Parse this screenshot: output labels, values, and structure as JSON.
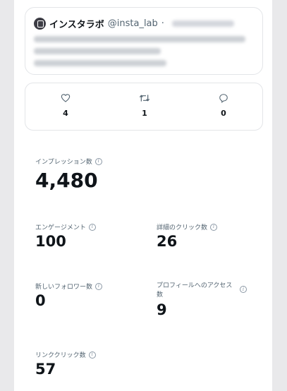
{
  "tweet": {
    "author_name": "インスタラボ",
    "author_handle": "@insta_lab",
    "separator": "·"
  },
  "engagement": {
    "likes": "4",
    "retweets": "1",
    "replies": "0",
    "icons": [
      "heart-icon",
      "retweet-icon",
      "reply-icon"
    ]
  },
  "metrics": {
    "impressions": {
      "label": "インプレッション数",
      "value": "4,480"
    },
    "engagements": {
      "label": "エンゲージメント",
      "value": "100"
    },
    "detail_clicks": {
      "label": "詳細のクリック数",
      "value": "26"
    },
    "new_followers": {
      "label": "新しいフォロワー数",
      "value": "0"
    },
    "profile_visits": {
      "label": "プロフィールへのアクセス数",
      "value": "9"
    },
    "link_clicks": {
      "label": "リンククリック数",
      "value": "57"
    }
  },
  "info_glyph": "i",
  "colors": {
    "text": "#0f1419",
    "muted": "#536471",
    "border": "#e3e5e8",
    "background": "#e9e9eb"
  }
}
